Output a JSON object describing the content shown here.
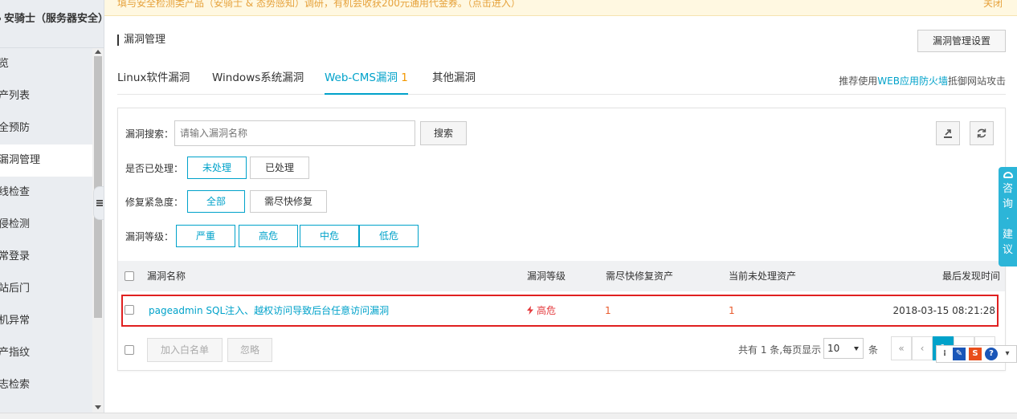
{
  "sidebar": {
    "header": "安骑士（服务器安全）",
    "items": [
      {
        "label": "览"
      },
      {
        "label": "产列表"
      },
      {
        "label": "全预防"
      },
      {
        "label": "漏洞管理",
        "active": true
      },
      {
        "label": "线检查"
      },
      {
        "label": "侵检测"
      },
      {
        "label": "常登录"
      },
      {
        "label": "站后门"
      },
      {
        "label": "机异常"
      },
      {
        "label": "产指纹"
      },
      {
        "label": "志检索"
      }
    ]
  },
  "banner": {
    "text": "填与安全检测类产品（安骑士 & 态势感知）调研，有机会收获200元通用代金券。（点击进入）",
    "close": "关闭"
  },
  "page": {
    "title": "漏洞管理",
    "settings_button": "漏洞管理设置"
  },
  "tabs": [
    {
      "label": "Linux软件漏洞",
      "count": ""
    },
    {
      "label": "Windows系统漏洞",
      "count": ""
    },
    {
      "label": "Web-CMS漏洞",
      "count": "1",
      "active": true
    },
    {
      "label": "其他漏洞",
      "count": ""
    }
  ],
  "tab_right": {
    "prefix": "推荐使用",
    "link": "WEB应用防火墙",
    "suffix": "抵御网站攻击"
  },
  "filters": {
    "search_label": "漏洞搜索：",
    "search_placeholder": "请输入漏洞名称",
    "search_button": "搜索",
    "processed_label": "是否已处理：",
    "processed_options": [
      "未处理",
      "已处理"
    ],
    "urgency_label": "修复紧急度：",
    "urgency_options": [
      "全部",
      "需尽快修复"
    ],
    "level_label": "漏洞等级：",
    "level_options": [
      "严重",
      "高危",
      "中危",
      "低危"
    ]
  },
  "table": {
    "headers": {
      "name": "漏洞名称",
      "level": "漏洞等级",
      "urgent_assets": "需尽快修复资产",
      "pending_assets": "当前未处理资产",
      "last_found": "最后发现时间"
    },
    "rows": [
      {
        "name": "pageadmin SQL注入、越权访问导致后台任意访问漏洞",
        "level": "高危",
        "urgent_assets": "1",
        "pending_assets": "1",
        "last_found": "2018-03-15 08:21:28"
      }
    ]
  },
  "footer": {
    "whitelist_button": "加入白名单",
    "ignore_button": "忽略",
    "total_text": "共有 1 条,每页显示",
    "page_size": "10",
    "unit": "条",
    "first": "«",
    "prev": "‹",
    "current_page": "1"
  },
  "consult": {
    "chars": [
      "咨",
      "询",
      "·",
      "建",
      "议"
    ]
  },
  "colors": {
    "accent": "#00a2ca",
    "danger": "#e4393c",
    "highlight_border": "#e02020",
    "banner_text": "#e6a23c"
  }
}
